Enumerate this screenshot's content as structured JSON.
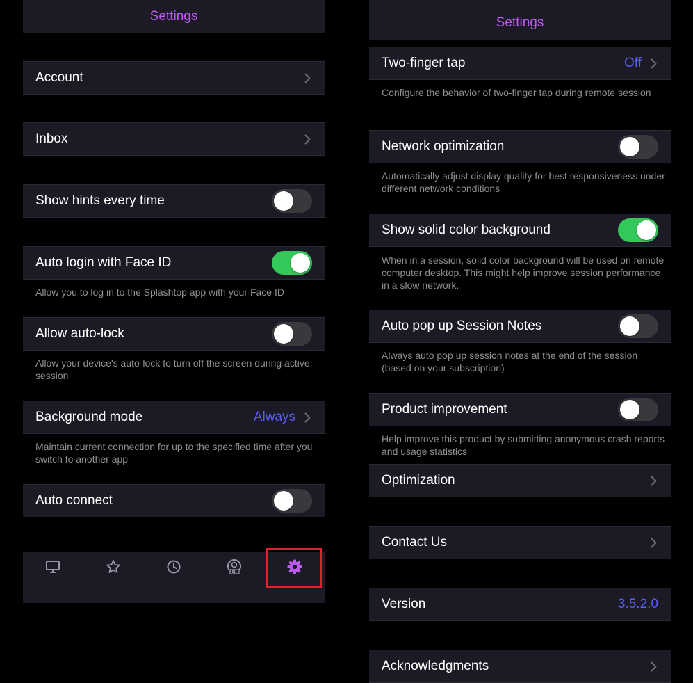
{
  "left": {
    "header": {
      "title": "Settings"
    },
    "rows": {
      "account": {
        "label": "Account"
      },
      "inbox": {
        "label": "Inbox"
      },
      "hints": {
        "label": "Show hints every time"
      },
      "faceid": {
        "label": "Auto login with Face ID",
        "desc": "Allow you to log in to the Splashtop app with your Face ID"
      },
      "autolock": {
        "label": "Allow auto-lock",
        "desc": "Allow your device's auto-lock to turn off the screen during active session"
      },
      "background": {
        "label": "Background mode",
        "value": "Always",
        "desc": "Maintain current connection for up to the specified time after you switch to another app"
      },
      "autoconnect": {
        "label": "Auto connect"
      }
    },
    "toggles": {
      "hints": false,
      "faceid": true,
      "autolock": false,
      "autoconnect": false
    },
    "tabbar": {
      "tabs": [
        {
          "icon": "monitor-icon",
          "active": false
        },
        {
          "icon": "star-icon",
          "active": false
        },
        {
          "icon": "clock-icon",
          "active": false
        },
        {
          "icon": "sos-icon",
          "active": false
        },
        {
          "icon": "gear-icon",
          "active": true
        }
      ]
    }
  },
  "right": {
    "header": {
      "title": "Settings"
    },
    "rows": {
      "twofinger": {
        "label": "Two-finger tap",
        "value": "Off",
        "desc": "Configure the behavior of two-finger tap during remote session"
      },
      "network": {
        "label": "Network optimization",
        "desc": "Automatically adjust display quality for best responsiveness under different network conditions"
      },
      "solidbg": {
        "label": "Show solid color background",
        "desc": "When in a session, solid color background will be used on remote computer desktop. This might help improve session performance in a slow network."
      },
      "notes": {
        "label": "Auto pop up Session Notes",
        "desc": "Always auto pop up session notes at the end of the session (based on your subscription)"
      },
      "improve": {
        "label": "Product improvement",
        "desc": "Help improve this product by submitting anonymous crash reports and usage statistics"
      },
      "optimization": {
        "label": "Optimization"
      },
      "contact": {
        "label": "Contact Us"
      },
      "version": {
        "label": "Version",
        "value": "3.5.2.0"
      },
      "ack": {
        "label": "Acknowledgments"
      }
    },
    "toggles": {
      "network": false,
      "solidbg": true,
      "notes": false,
      "improve": false
    }
  },
  "colors": {
    "accent": "#bf5af2",
    "link": "#5a5cf2",
    "toggle_on": "#34c759",
    "highlight": "#e0232b"
  }
}
